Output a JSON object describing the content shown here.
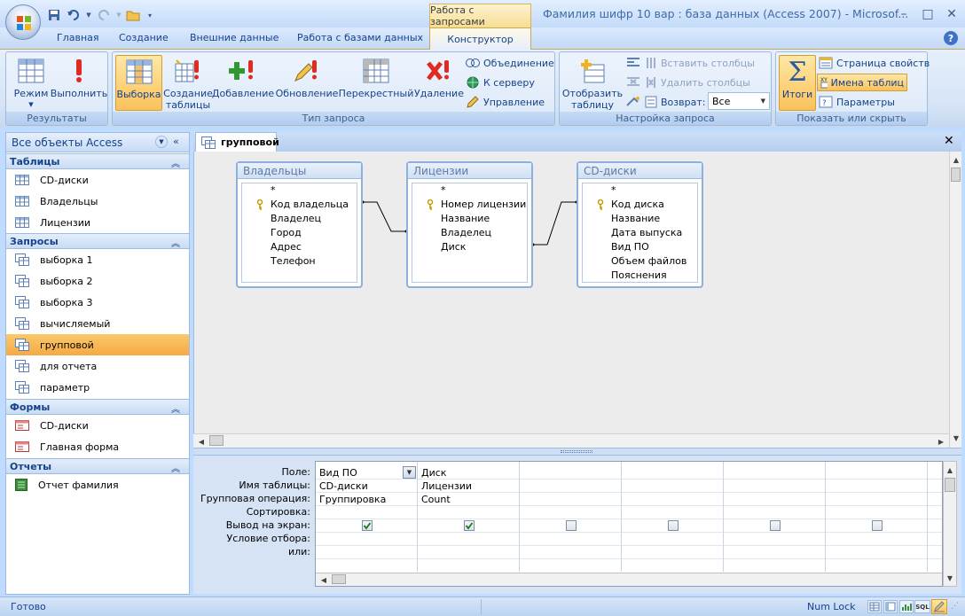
{
  "window": {
    "title": "Фамилия шифр 10 вар : база данных (Access 2007) - Microsof...",
    "context_tab": "Работа с запросами",
    "controls": {
      "minimize": "–",
      "maximize": "□",
      "close": "✕"
    }
  },
  "tabs": [
    "Главная",
    "Создание",
    "Внешние данные",
    "Работа с базами данных"
  ],
  "active_tab": "Конструктор",
  "ribbon": {
    "results": {
      "label": "Результаты",
      "mode": "Режим",
      "run": "Выполнить"
    },
    "query_type": {
      "label": "Тип запроса",
      "select": "Выборка",
      "make_table_1": "Создание",
      "make_table_2": "таблицы",
      "append": "Добавление",
      "update": "Обновление",
      "crosstab": "Перекрестный",
      "delete": "Удаление",
      "union": "Объединение",
      "to_server": "К серверу",
      "manage": "Управление"
    },
    "setup": {
      "label": "Настройка запроса",
      "show_table_1": "Отобразить",
      "show_table_2": "таблицу",
      "insert_columns": "Вставить столбцы",
      "delete_columns": "Удалить столбцы",
      "return_label": "Возврат:",
      "return_value": "Все"
    },
    "show_hide": {
      "label": "Показать или скрыть",
      "totals": "Итоги",
      "property_sheet": "Страница свойств",
      "table_names": "Имена таблиц",
      "parameters": "Параметры"
    }
  },
  "nav": {
    "header": "Все объекты Access",
    "sections": [
      {
        "title": "Таблицы",
        "items": [
          "CD-диски",
          "Владельцы",
          "Лицензии"
        ]
      },
      {
        "title": "Запросы",
        "items": [
          "выборка 1",
          "выборка 2",
          "выборка 3",
          "вычисляемый",
          "групповой",
          "для отчета",
          "параметр"
        ]
      },
      {
        "title": "Формы",
        "items": [
          "CD-диски",
          "Главная форма"
        ]
      },
      {
        "title": "Отчеты",
        "items": [
          "Отчет фамилия"
        ]
      }
    ],
    "selected": "групповой"
  },
  "document": {
    "tab": "групповой"
  },
  "tables": [
    {
      "name": "Владельцы",
      "fields": [
        "*",
        "Код владельца",
        "Владелец",
        "Город",
        "Адрес",
        "Телефон"
      ],
      "key": "Код владельца"
    },
    {
      "name": "Лицензии",
      "fields": [
        "*",
        "Номер лицензии",
        "Название",
        "Владелец",
        "Диск"
      ],
      "key": "Номер лицензии"
    },
    {
      "name": "CD-диски",
      "fields": [
        "*",
        "Код диска",
        "Название",
        "Дата выпуска",
        "Вид ПО",
        "Объем файлов",
        "Пояснения"
      ],
      "key": "Код диска"
    }
  ],
  "grid": {
    "row_labels": [
      "Поле:",
      "Имя таблицы:",
      "Групповая операция:",
      "Сортировка:",
      "Вывод на экран:",
      "Условие отбора:",
      "или:"
    ],
    "columns": [
      {
        "field": "Вид ПО",
        "table": "CD-диски",
        "total": "Группировка",
        "show": true
      },
      {
        "field": "Диск",
        "table": "Лицензии",
        "total": "Count",
        "show": true
      },
      {
        "field": "",
        "table": "",
        "total": "",
        "show": false
      },
      {
        "field": "",
        "table": "",
        "total": "",
        "show": false
      },
      {
        "field": "",
        "table": "",
        "total": "",
        "show": false
      },
      {
        "field": "",
        "table": "",
        "total": "",
        "show": false
      }
    ]
  },
  "status": {
    "left": "Готово",
    "numlock": "Num Lock",
    "sql": "SQL"
  }
}
